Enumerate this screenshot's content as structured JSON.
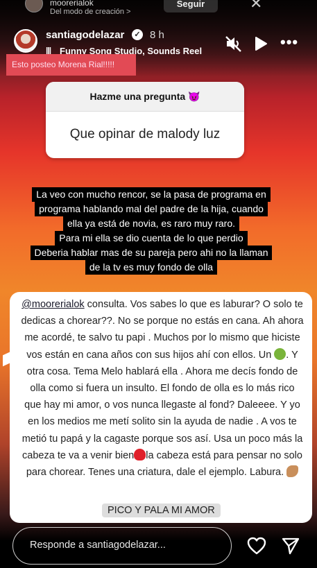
{
  "top_bar": {
    "handle": "moorerialok",
    "subtitle": "Del modo de creación >",
    "follow_label": "Seguir",
    "close_glyph": "✕"
  },
  "header": {
    "username": "santiagodelazar",
    "time": "8 h",
    "song": "Funny Song Studio, Sounds Reel",
    "icons": [
      "music-icon",
      "mute-icon",
      "play-icon",
      "more-icon"
    ]
  },
  "caption_sticker": "Esto posteo Morena Rial!!!!!",
  "question_box": {
    "header": "Hazme una pregunta 😈",
    "answer": "Que opinar de malody luz"
  },
  "answer_lines": [
    "La veo con mucho rencor, se la pasa de programa en",
    "programa hablando mal del padre de la hija, cuando",
    "ella ya está de novia, es raro muy raro.",
    "Para mi ella se dio cuenta de lo que perdio",
    "Deberia hablar mas de su pareja pero ahi no la llaman",
    "de la tv es muy fondo de olla"
  ],
  "comment": {
    "mention": "@moorerialok",
    "text_1": " consulta. Vos sabes lo que es laburar? O solo te dedicas a chorear??. No se porque no estás en cana.  Ah ahora me acordé, te salvo tu papi  . Muchos por lo mismo que hiciste vos están en cana años con sus hijos ahí con ellos. Un ",
    "text_2": ". Y otra cosa. Tema Melo hablará ella . Ahora me decís fondo de olla como si fuera un insulto. El fondo de olla es lo más rico que hay mi amor, o vos nunca llegaste al fond? Daleeee. Y yo en los medios me metí solito sin  la ayuda de nadie . A vos te metió tu papá y la cagaste porque sos así. Usa un poco más la cabeza te va a venir bien",
    "text_3": "la cabeza está para pensar no solo para chorear. Tenes una criatura, dale el ejemplo. Labura.",
    "closing": "PICO Y PALA MI AMOR"
  },
  "reply": {
    "placeholder": "Responde a santiagodelazar..."
  },
  "colors": {
    "caption_bg": "#e24a55",
    "gradient_mid": "#f26b2a"
  }
}
